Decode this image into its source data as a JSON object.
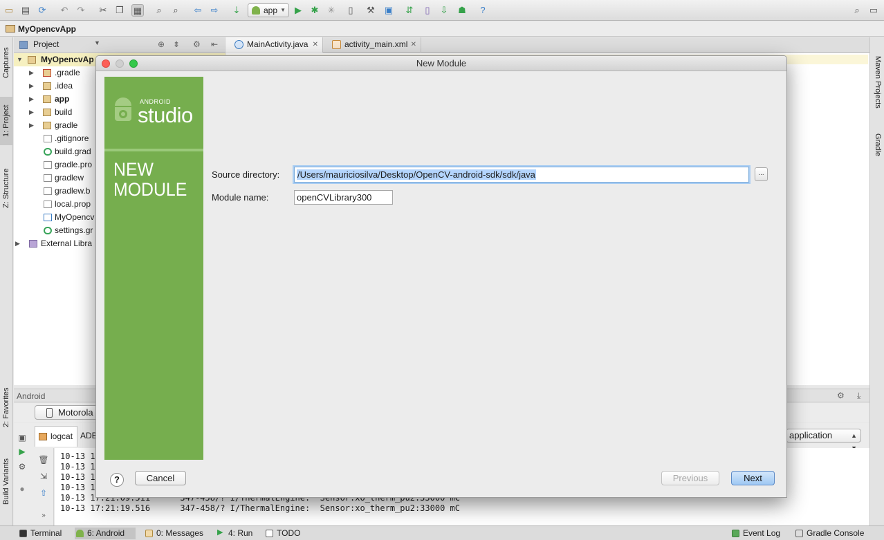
{
  "toolbar": {
    "run_config": "app",
    "icons": [
      "open-icon",
      "save-icon",
      "sync-icon",
      "undo-icon",
      "redo-icon",
      "cut-icon",
      "copy-icon",
      "paste-icon",
      "find-icon",
      "replace-icon",
      "back-icon",
      "forward-icon",
      "make-icon",
      "run-icon",
      "debug-icon",
      "attach-debugger-icon",
      "device-monitor-icon",
      "project-structure-icon",
      "sdk-manager-icon",
      "avd-manager-icon",
      "gradle-sync-icon",
      "android-monitor-icon",
      "help-icon",
      "search-everywhere-icon",
      "layout-icon"
    ]
  },
  "breadcrumb": {
    "project": "MyOpencvApp"
  },
  "left_strip": {
    "tabs": [
      "Captures",
      "1: Project",
      "Z: Structure",
      "2: Favorites",
      "Build Variants"
    ]
  },
  "right_strip": {
    "tabs": [
      "Maven Projects",
      "Gradle"
    ]
  },
  "project_pane": {
    "title": "Project",
    "tree": [
      {
        "label": "MyOpencvAp",
        "icon": "folder",
        "expanded": true
      },
      {
        "label": ".gradle",
        "icon": "folder"
      },
      {
        "label": ".idea",
        "icon": "folder"
      },
      {
        "label": "app",
        "icon": "folder"
      },
      {
        "label": "build",
        "icon": "folder"
      },
      {
        "label": "gradle",
        "icon": "folder"
      },
      {
        "label": ".gitignore",
        "icon": "file"
      },
      {
        "label": "build.grad",
        "icon": "gradle"
      },
      {
        "label": "gradle.pro",
        "icon": "file"
      },
      {
        "label": "gradlew",
        "icon": "file"
      },
      {
        "label": "gradlew.b",
        "icon": "file"
      },
      {
        "label": "local.prop",
        "icon": "file"
      },
      {
        "label": "MyOpencv",
        "icon": "file"
      },
      {
        "label": "settings.gr",
        "icon": "gradle"
      },
      {
        "label": "External Libra",
        "icon": "lib"
      }
    ]
  },
  "editor_tabs": [
    {
      "label": "MainActivity.java",
      "icon": "java-class"
    },
    {
      "label": "activity_main.xml",
      "icon": "xml-file"
    }
  ],
  "android_pane": {
    "title": "Android",
    "device": "Motorola",
    "tabs": [
      "logcat",
      "ADB"
    ],
    "app_filter": "application",
    "log_lines": [
      "10-13 17",
      "10-13 17",
      "10-13 17",
      "10-13 17",
      "10-13 17:21:09.511      347-458/? I/ThermalEngine:  Sensor:xo_therm_pu2:33000 mC",
      "10-13 17:21:19.516      347-458/? I/ThermalEngine:  Sensor:xo_therm_pu2:33000 mC"
    ]
  },
  "status_bar": {
    "left": [
      {
        "label": "Terminal"
      },
      {
        "label": "6: Android"
      },
      {
        "label": "0: Messages"
      },
      {
        "label": "4: Run"
      },
      {
        "label": "TODO"
      }
    ],
    "right": [
      {
        "label": "Event Log"
      },
      {
        "label": "Gradle Console"
      }
    ]
  },
  "dialog": {
    "title": "New Module",
    "banner": {
      "brand_small": "ANDROID",
      "brand_large": "studio",
      "heading": "NEW MODULE"
    },
    "source_directory_label": "Source directory:",
    "source_directory_value": "/Users/mauriciosilva/Desktop/OpenCV-android-sdk/sdk/java",
    "browse_label": "...",
    "module_name_label": "Module name:",
    "module_name_value": "openCVLibrary300",
    "help_label": "?",
    "cancel_label": "Cancel",
    "previous_label": "Previous",
    "next_label": "Next"
  },
  "colors": {
    "banner_green": "#76ae4e",
    "selection_blue": "#b3d4fc",
    "default_button": "#9ec8f3"
  }
}
